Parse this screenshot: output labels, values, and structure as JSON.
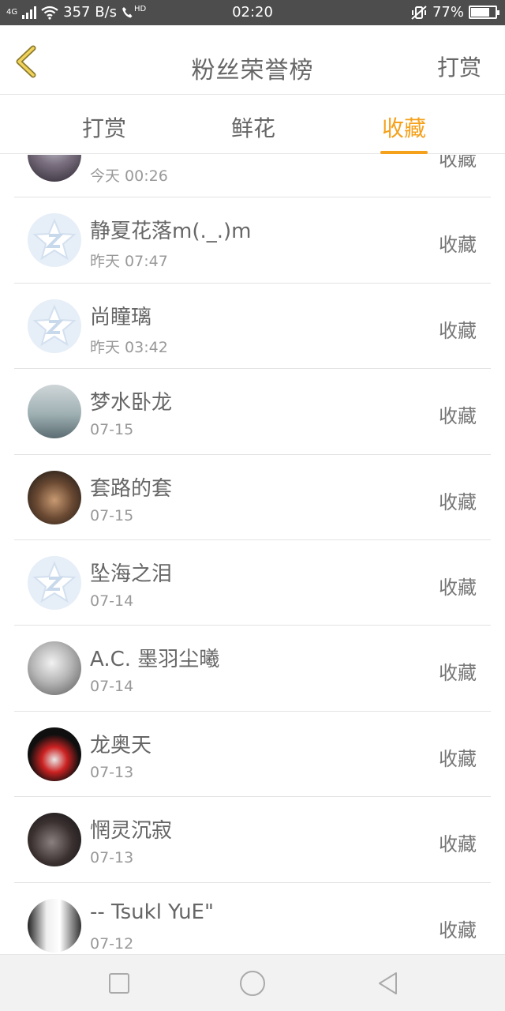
{
  "status_bar": {
    "network": "4G",
    "speed": "357 B/s",
    "call_badge": "HD",
    "time": "02:20",
    "battery": "77%",
    "battery_level": 0.77
  },
  "header": {
    "title": "粉丝荣誉榜",
    "action": "打赏"
  },
  "tabs": [
    {
      "label": "打赏",
      "active": false
    },
    {
      "label": "鲜花",
      "active": false
    },
    {
      "label": "收藏",
      "active": true
    }
  ],
  "rows": [
    {
      "name": "",
      "time": "今天 00:26",
      "tag": "收藏",
      "avatar": "photo-avatar"
    },
    {
      "name": "静夏花落m(._.)m",
      "time": "昨天 07:47",
      "tag": "收藏",
      "avatar": "default-avatar"
    },
    {
      "name": "尚瞳璃",
      "time": "昨天 03:42",
      "tag": "收藏",
      "avatar": "default-avatar"
    },
    {
      "name": "梦水卧龙",
      "time": "07-15",
      "tag": "收藏",
      "avatar": "photo-avatar"
    },
    {
      "name": "套路的套",
      "time": "07-15",
      "tag": "收藏",
      "avatar": "photo-avatar"
    },
    {
      "name": "坠海之泪",
      "time": "07-14",
      "tag": "收藏",
      "avatar": "default-avatar"
    },
    {
      "name": "A.C. 墨羽尘曦",
      "time": "07-14",
      "tag": "收藏",
      "avatar": "photo-avatar"
    },
    {
      "name": "龙奥天",
      "time": "07-13",
      "tag": "收藏",
      "avatar": "photo-avatar"
    },
    {
      "name": "惘灵沉寂",
      "time": "07-13",
      "tag": "收藏",
      "avatar": "photo-avatar"
    },
    {
      "name": "-- Tsukl YuE\"",
      "time": "07-12",
      "tag": "收藏",
      "avatar": "photo-avatar"
    }
  ],
  "colors": {
    "accent": "#f5a11c",
    "status_bar": "#4d4d4d"
  }
}
